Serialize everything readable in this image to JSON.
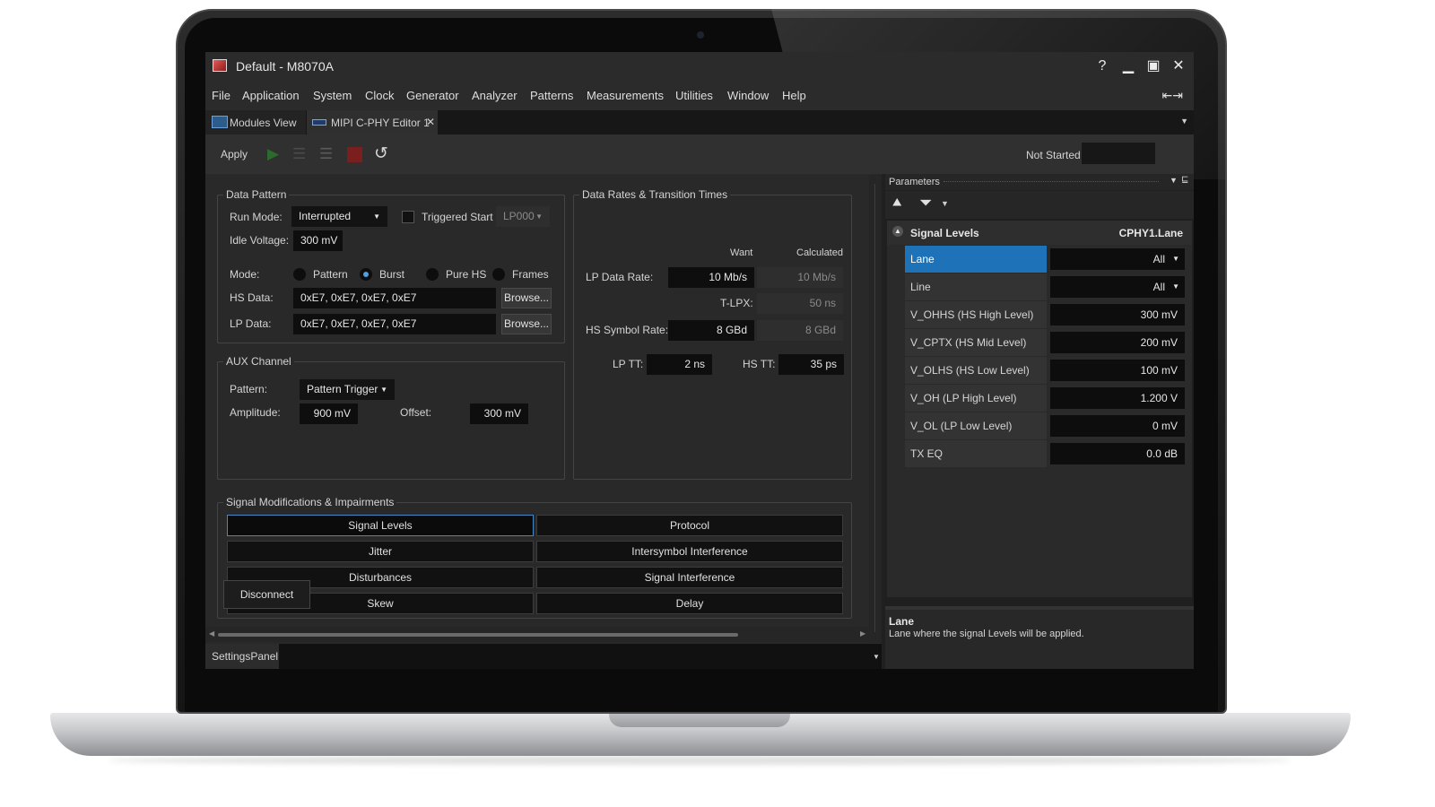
{
  "window": {
    "title": "Default - M8070A"
  },
  "menu": [
    "File",
    "Application",
    "System",
    "Clock",
    "Generator",
    "Analyzer",
    "Patterns",
    "Measurements",
    "Utilities",
    "Window",
    "Help"
  ],
  "tabs": [
    {
      "label": "Modules View"
    },
    {
      "label": "MIPI C-PHY Editor 1"
    }
  ],
  "toolbar": {
    "apply": "Apply",
    "status": "Not Started"
  },
  "data_pattern": {
    "title": "Data Pattern",
    "run_mode_label": "Run Mode:",
    "run_mode": "Interrupted",
    "triggered_start_label": "Triggered Start",
    "trigger": "LP000",
    "idle_voltage_label": "Idle Voltage:",
    "idle_voltage": "300 mV",
    "mode_label": "Mode:",
    "modes": [
      "Pattern",
      "Burst",
      "Pure HS",
      "Frames"
    ],
    "hs_data_label": "HS Data:",
    "hs_data": "0xE7, 0xE7, 0xE7, 0xE7",
    "lp_data_label": "LP Data:",
    "lp_data": "0xE7, 0xE7, 0xE7, 0xE7",
    "browse": "Browse..."
  },
  "aux": {
    "title": "AUX Channel",
    "pattern_label": "Pattern:",
    "pattern": "Pattern Trigger",
    "amplitude_label": "Amplitude:",
    "amplitude": "900 mV",
    "offset_label": "Offset:",
    "offset": "300 mV"
  },
  "rates": {
    "title": "Data Rates & Transition Times",
    "want_header": "Want",
    "calculated_header": "Calculated",
    "lp_data_rate_label": "LP Data Rate:",
    "lp_data_rate_want": "10 Mb/s",
    "lp_data_rate_calc": "10 Mb/s",
    "t_lpx_label": "T-LPX:",
    "t_lpx_calc": "50 ns",
    "hs_symbol_rate_label": "HS Symbol Rate:",
    "hs_symbol_rate_want": "8 GBd",
    "hs_symbol_rate_calc": "8 GBd",
    "lp_tt_label": "LP TT:",
    "lp_tt": "2 ns",
    "hs_tt_label": "HS TT:",
    "hs_tt": "35 ps"
  },
  "signal_mods": {
    "title": "Signal Modifications & Impairments",
    "buttons": [
      "Signal Levels",
      "Protocol",
      "Jitter",
      "Intersymbol Interference",
      "Disturbances",
      "Signal Interference",
      "Skew",
      "Delay"
    ]
  },
  "disconnect": "Disconnect",
  "settings_panel": "SettingsPanel",
  "params": {
    "title": "Parameters",
    "section": "Signal Levels",
    "section_target": "CPHY1.Lane",
    "rows": [
      {
        "name": "Lane",
        "value": "All"
      },
      {
        "name": "Line",
        "value": "All"
      },
      {
        "name": "V_OHHS (HS High Level)",
        "value": "300 mV"
      },
      {
        "name": "V_CPTX (HS Mid Level)",
        "value": "200 mV"
      },
      {
        "name": "V_OLHS (HS Low Level)",
        "value": "100 mV"
      },
      {
        "name": "V_OH (LP High Level)",
        "value": "1.200 V"
      },
      {
        "name": "V_OL (LP Low Level)",
        "value": "0 mV"
      },
      {
        "name": "TX EQ",
        "value": "0.0 dB"
      }
    ],
    "desc_title": "Lane",
    "desc_text": "Lane where the signal Levels will be applied."
  }
}
